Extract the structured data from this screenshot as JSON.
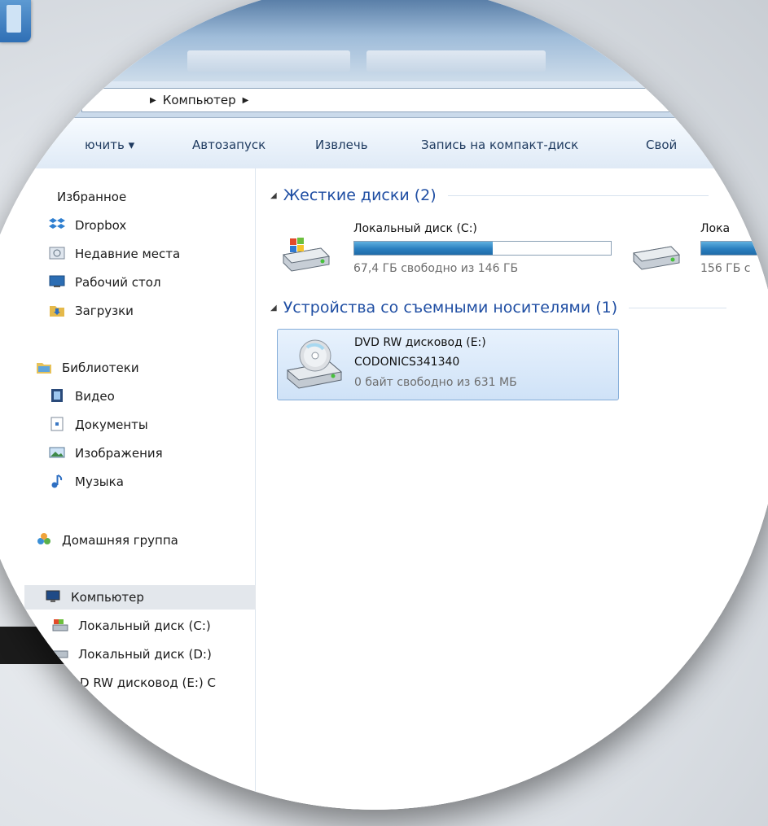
{
  "address_bar": {
    "crumb": "Компьютер"
  },
  "toolbar": {
    "organize_label": "ючить ▾",
    "autorun_label": "Автозапуск",
    "eject_label": "Извлечь",
    "burn_label": "Запись на компакт-диск",
    "properties_label": "Свой"
  },
  "nav": {
    "favorites": "Избранное",
    "dropbox": "Dropbox",
    "recent": "Недавние места",
    "desktop": "Рабочий стол",
    "downloads": "Загрузки",
    "libraries": "Библиотеки",
    "video": "Видео",
    "documents": "Документы",
    "pictures": "Изображения",
    "music": "Музыка",
    "homegroup": "Домашняя группа",
    "computer": "Компьютер",
    "disk_c": "Локальный диск (C:)",
    "disk_d": "Локальный диск (D:)",
    "dvd": "D RW дисковод (E:) C"
  },
  "main": {
    "hard_disks_header": "Жесткие диски (2)",
    "removable_header": "Устройства со съемными носителями (1)",
    "drive_c": {
      "name": "Локальный диск (C:)",
      "free_text": "67,4 ГБ свободно из 146 ГБ",
      "used_fraction": 0.54
    },
    "drive_d": {
      "name": "Лока",
      "free_text": "156 ГБ с",
      "used_fraction": 0.9
    },
    "dvd": {
      "name": "DVD RW дисковод (E:)",
      "label": "CODONICS341340",
      "free_text": "0 байт свободно из 631 МБ"
    }
  },
  "colors": {
    "accent": "#1f4ea3",
    "bar_fill": "#2a7fbf",
    "selection": "#cfe2f7"
  }
}
